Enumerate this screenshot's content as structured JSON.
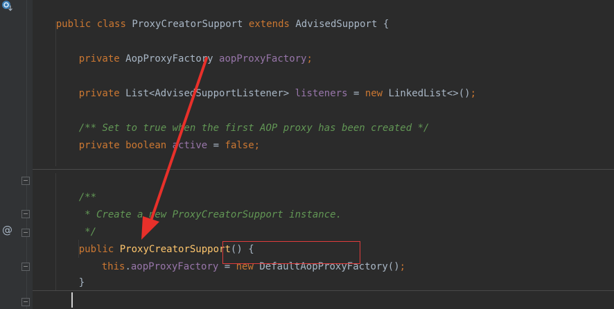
{
  "code": {
    "line1": {
      "public": "public",
      "class": "class",
      "name": "ProxyCreatorSupport",
      "extends": "extends",
      "parent": "AdvisedSupport",
      "brace": "{"
    },
    "line2": {
      "private": "private",
      "type": "AopProxyFactory",
      "field": "aopProxyFactory",
      "semi": ";"
    },
    "line3": {
      "private": "private",
      "type_a": "List<",
      "type_b": "AdvisedSupportListener",
      "type_c": ">",
      "field": "listeners",
      "eq": "=",
      "new": "new",
      "ctor": "LinkedList<>()",
      "semi": ";"
    },
    "line4": {
      "comment": "/** Set to true when the first AOP proxy has been created */"
    },
    "line5": {
      "private": "private",
      "boolean": "boolean",
      "field": "active",
      "eq": "=",
      "false": "false",
      "semi": ";"
    },
    "line6": {
      "doc": "/**"
    },
    "line7": {
      "doc": " * Create a new ProxyCreatorSupport instance."
    },
    "line8": {
      "doc": " */"
    },
    "line9": {
      "public": "public",
      "name": "ProxyCreatorSupport",
      "parens": "()",
      "brace": "{"
    },
    "line10": {
      "this": "this",
      "dot": ".",
      "field": "aopProxyFactory",
      "eq": "=",
      "new": "new",
      "ctor": "DefaultAopProxyFactory",
      "parens": "()",
      "semi": ";"
    },
    "line11": {
      "brace": "}"
    },
    "line12": {
      "doc": "/**"
    }
  },
  "gutter": {
    "override_marker": "@",
    "colors": {
      "background": "#313335",
      "editor": "#2b2b2b"
    }
  },
  "annotation": {
    "box_color": "#e23c3c",
    "arrow_color": "#e8302a"
  }
}
